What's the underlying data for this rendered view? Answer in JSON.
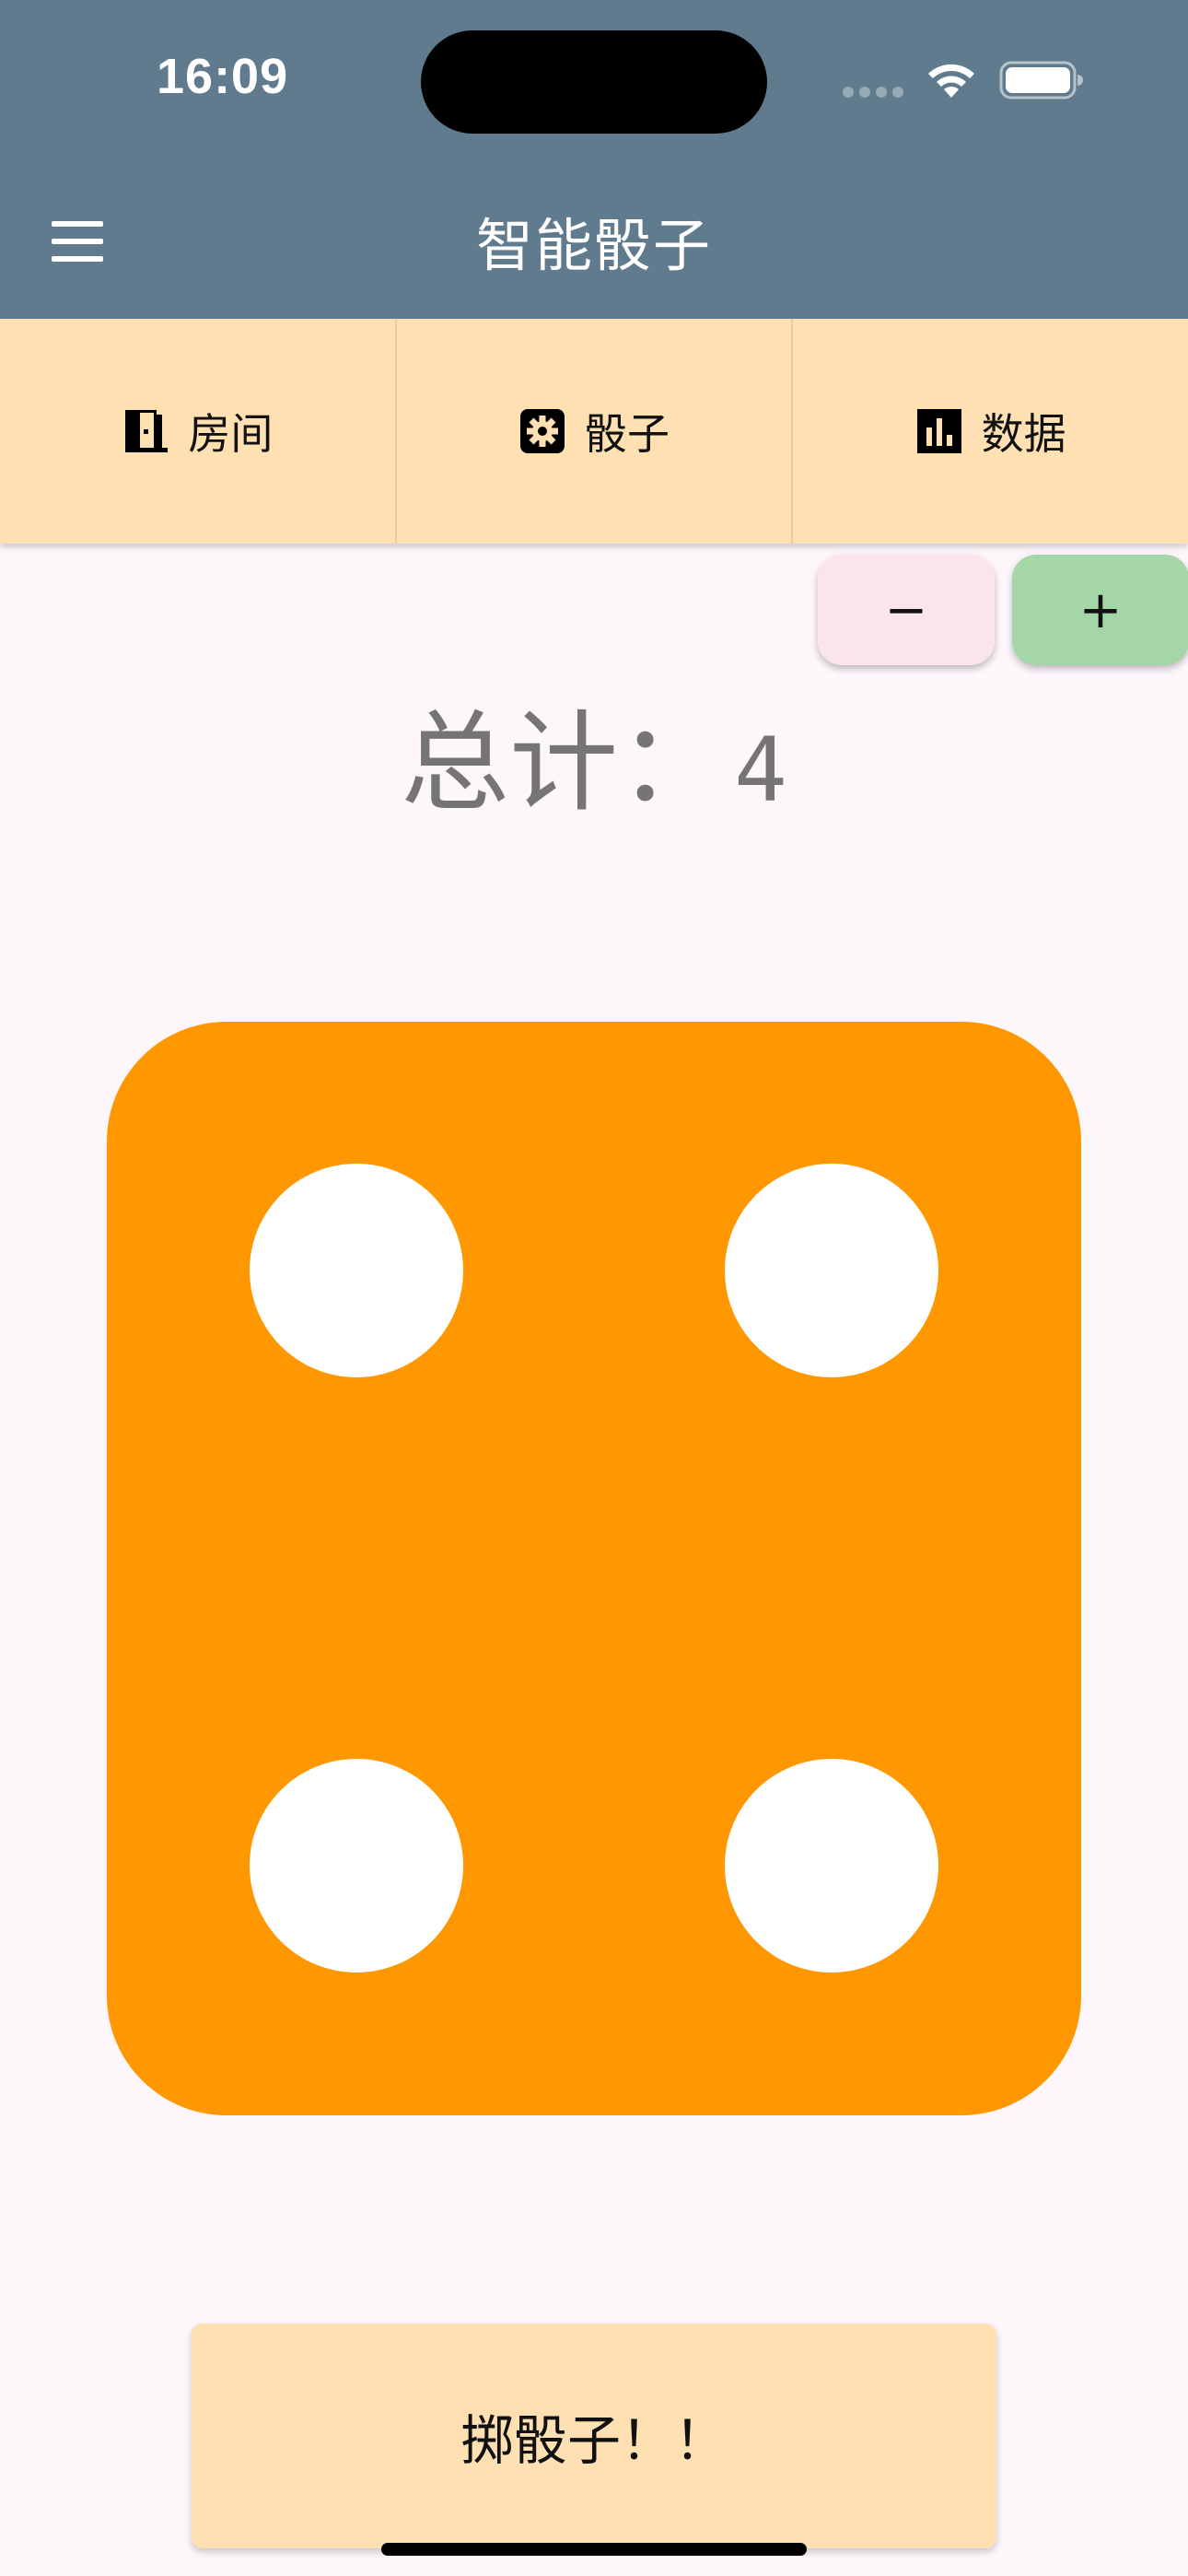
{
  "status_bar": {
    "time": "16:09"
  },
  "app_bar": {
    "title": "智能骰子",
    "background_color": "#607B8D"
  },
  "tabs": [
    {
      "label": "房间",
      "icon": "door-icon"
    },
    {
      "label": "骰子",
      "icon": "gear-icon"
    },
    {
      "label": "数据",
      "icon": "bar-chart-icon"
    }
  ],
  "stepper": {
    "minus_label": "−",
    "plus_label": "+"
  },
  "total": {
    "label": "总计：",
    "value": "4"
  },
  "die": {
    "face_value": 4,
    "color": "#FF9800",
    "pip_color": "#FFFFFF"
  },
  "roll_button": {
    "label": "掷骰子！！"
  },
  "colors": {
    "tab_background": "#FFE0B2",
    "minus_button": "#FCE4EC",
    "plus_button": "#A5D6A7",
    "page_background": "#FDF7FC"
  }
}
